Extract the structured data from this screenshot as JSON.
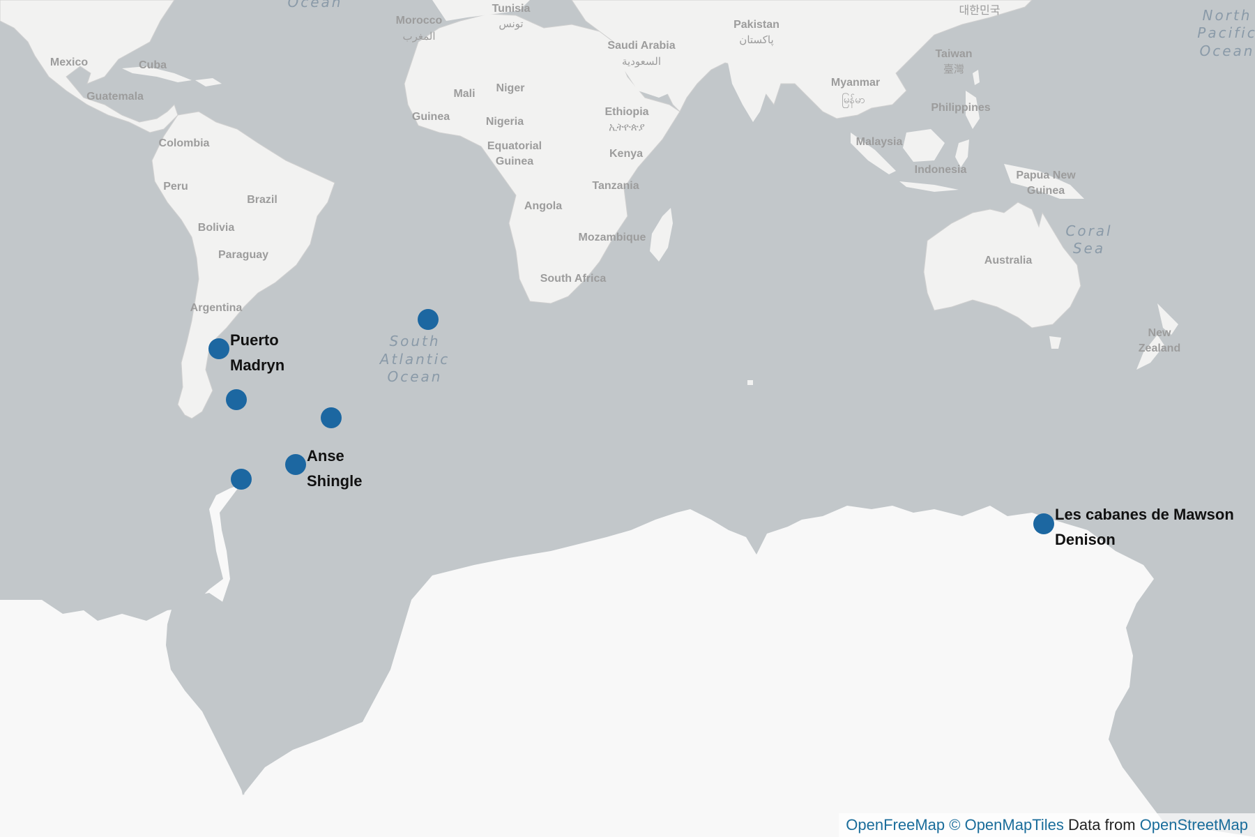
{
  "map": {
    "colors": {
      "water": "#c2c7ca",
      "land": "#f2f2f1",
      "ice": "#f8f8f8",
      "marker": "#1c67a1"
    },
    "country_labels": {
      "morocco": "Morocco",
      "tunisia": "Tunisia",
      "south_korea": "대한민국",
      "pakistan": "Pakistan",
      "mexico": "Mexico",
      "cuba": "Cuba",
      "guatemala": "Guatemala",
      "saudi_arabia": "Saudi Arabia",
      "mali": "Mali",
      "niger": "Niger",
      "myanmar": "Myanmar",
      "taiwan": "Taiwan",
      "philippines": "Philippines",
      "guinea": "Guinea",
      "nigeria": "Nigeria",
      "ethiopia": "Ethiopia",
      "colombia": "Colombia",
      "equatorial_guinea_1": "Equatorial",
      "equatorial_guinea_2": "Guinea",
      "kenya": "Kenya",
      "malaysia": "Malaysia",
      "indonesia": "Indonesia",
      "papua_1": "Papua New",
      "papua_2": "Guinea",
      "peru": "Peru",
      "brazil": "Brazil",
      "tanzania": "Tanzania",
      "angola": "Angola",
      "bolivia": "Bolivia",
      "mozambique": "Mozambique",
      "paraguay": "Paraguay",
      "australia": "Australia",
      "south_africa": "South Africa",
      "argentina": "Argentina",
      "new_zealand_1": "New",
      "new_zealand_2": "Zealand",
      "morocco_native": "المغرب",
      "tunisia_native": "تونس",
      "saudi_native": "السعودية",
      "pakistan_native": "پاکستان",
      "ethiopia_native": "ኢትዮጵያ",
      "myanmar_native": "မြန်မာ",
      "taiwan_native": "臺灣"
    },
    "ocean_labels": {
      "north_atlantic": "Ocean",
      "north_pacific_1": "North",
      "north_pacific_2": "Pacific",
      "north_pacific_3": "Ocean",
      "coral_sea_1": "Coral",
      "coral_sea_2": "Sea",
      "south_atlantic_1": "South",
      "south_atlantic_2": "Atlantic",
      "south_atlantic_3": "Ocean"
    },
    "markers": {
      "puerto_madryn": {
        "line1": "Puerto",
        "line2": "Madryn"
      },
      "anse_shingle": {
        "line1": "Anse",
        "line2": "Shingle"
      },
      "mawson": {
        "line1": "Les cabanes de Mawson",
        "line2": "Denison"
      },
      "falklands": {},
      "south_georgia": {},
      "antarctic_peninsula": {},
      "tristan": {}
    },
    "attribution": {
      "openfreemap": "OpenFreeMap",
      "openmaptiles": "© OpenMapTiles",
      "data_from": "Data from",
      "openstreetmap": "OpenStreetMap"
    }
  }
}
